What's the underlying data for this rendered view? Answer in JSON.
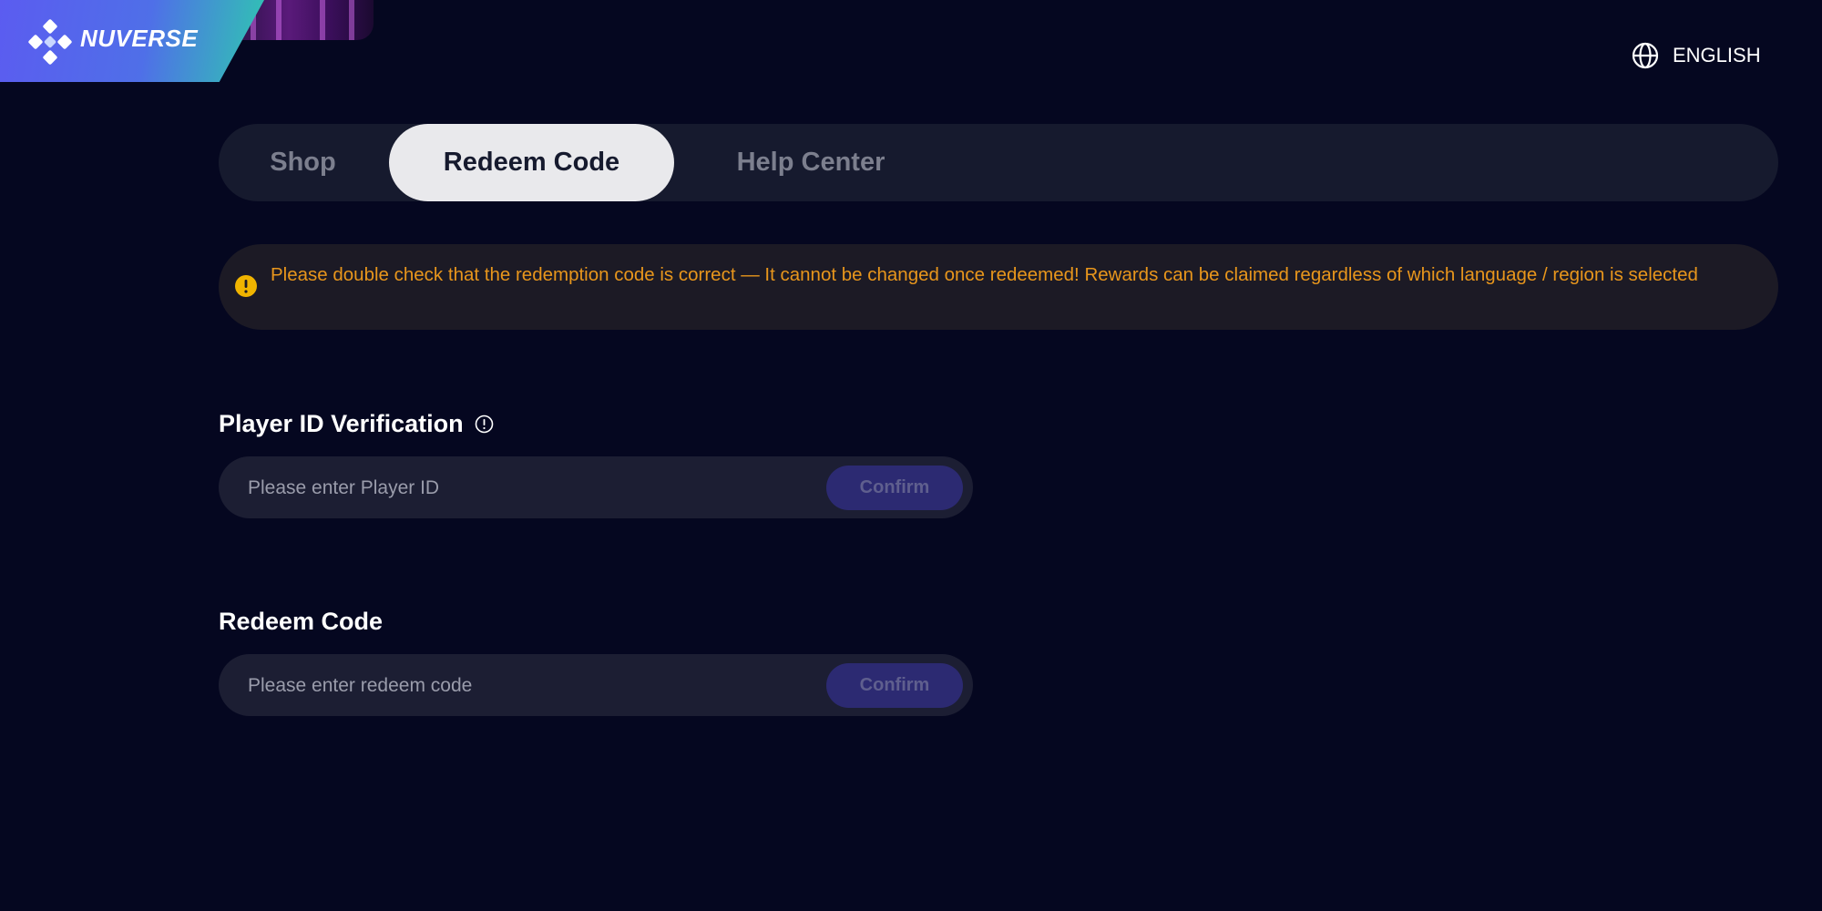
{
  "brand": {
    "name": "NUVERSE"
  },
  "header": {
    "language_label": "ENGLISH"
  },
  "tabs": [
    {
      "label": "Shop",
      "active": false
    },
    {
      "label": "Redeem Code",
      "active": true
    },
    {
      "label": "Help Center",
      "active": false
    }
  ],
  "notice": {
    "text": "Please double check that the redemption code is correct — It cannot be changed once redeemed! Rewards can be claimed regardless of which language / region is selected",
    "icon": "warning-icon"
  },
  "player_section": {
    "title": "Player ID Verification",
    "info_icon": "info-icon",
    "input_placeholder": "Please enter Player ID",
    "input_value": "",
    "button_label": "Confirm"
  },
  "redeem_section": {
    "title": "Redeem Code",
    "input_placeholder": "Please enter redeem code",
    "input_value": "",
    "button_label": "Confirm"
  },
  "colors": {
    "background": "#050720",
    "accent": "#2c2a72",
    "warning": "#e8961c",
    "brand_gradient_start": "#5b5cf0",
    "brand_gradient_end": "#2fc7b0"
  }
}
